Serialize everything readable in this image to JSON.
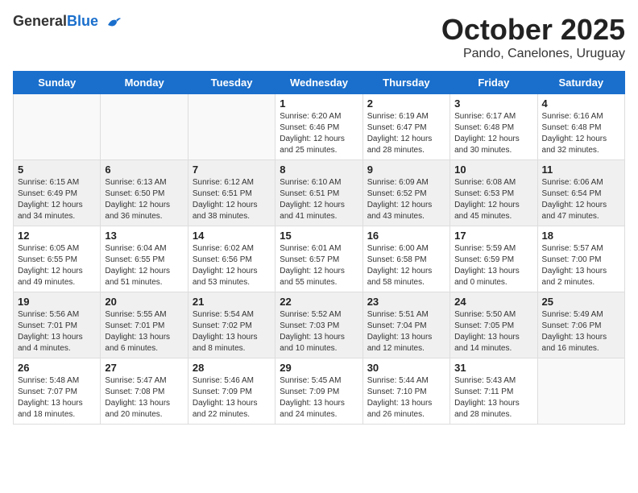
{
  "logo": {
    "general": "General",
    "blue": "Blue"
  },
  "title": "October 2025",
  "location": "Pando, Canelones, Uruguay",
  "days_of_week": [
    "Sunday",
    "Monday",
    "Tuesday",
    "Wednesday",
    "Thursday",
    "Friday",
    "Saturday"
  ],
  "weeks": [
    {
      "shaded": false,
      "days": [
        {
          "num": "",
          "info": ""
        },
        {
          "num": "",
          "info": ""
        },
        {
          "num": "",
          "info": ""
        },
        {
          "num": "1",
          "info": "Sunrise: 6:20 AM\nSunset: 6:46 PM\nDaylight: 12 hours\nand 25 minutes."
        },
        {
          "num": "2",
          "info": "Sunrise: 6:19 AM\nSunset: 6:47 PM\nDaylight: 12 hours\nand 28 minutes."
        },
        {
          "num": "3",
          "info": "Sunrise: 6:17 AM\nSunset: 6:48 PM\nDaylight: 12 hours\nand 30 minutes."
        },
        {
          "num": "4",
          "info": "Sunrise: 6:16 AM\nSunset: 6:48 PM\nDaylight: 12 hours\nand 32 minutes."
        }
      ]
    },
    {
      "shaded": true,
      "days": [
        {
          "num": "5",
          "info": "Sunrise: 6:15 AM\nSunset: 6:49 PM\nDaylight: 12 hours\nand 34 minutes."
        },
        {
          "num": "6",
          "info": "Sunrise: 6:13 AM\nSunset: 6:50 PM\nDaylight: 12 hours\nand 36 minutes."
        },
        {
          "num": "7",
          "info": "Sunrise: 6:12 AM\nSunset: 6:51 PM\nDaylight: 12 hours\nand 38 minutes."
        },
        {
          "num": "8",
          "info": "Sunrise: 6:10 AM\nSunset: 6:51 PM\nDaylight: 12 hours\nand 41 minutes."
        },
        {
          "num": "9",
          "info": "Sunrise: 6:09 AM\nSunset: 6:52 PM\nDaylight: 12 hours\nand 43 minutes."
        },
        {
          "num": "10",
          "info": "Sunrise: 6:08 AM\nSunset: 6:53 PM\nDaylight: 12 hours\nand 45 minutes."
        },
        {
          "num": "11",
          "info": "Sunrise: 6:06 AM\nSunset: 6:54 PM\nDaylight: 12 hours\nand 47 minutes."
        }
      ]
    },
    {
      "shaded": false,
      "days": [
        {
          "num": "12",
          "info": "Sunrise: 6:05 AM\nSunset: 6:55 PM\nDaylight: 12 hours\nand 49 minutes."
        },
        {
          "num": "13",
          "info": "Sunrise: 6:04 AM\nSunset: 6:55 PM\nDaylight: 12 hours\nand 51 minutes."
        },
        {
          "num": "14",
          "info": "Sunrise: 6:02 AM\nSunset: 6:56 PM\nDaylight: 12 hours\nand 53 minutes."
        },
        {
          "num": "15",
          "info": "Sunrise: 6:01 AM\nSunset: 6:57 PM\nDaylight: 12 hours\nand 55 minutes."
        },
        {
          "num": "16",
          "info": "Sunrise: 6:00 AM\nSunset: 6:58 PM\nDaylight: 12 hours\nand 58 minutes."
        },
        {
          "num": "17",
          "info": "Sunrise: 5:59 AM\nSunset: 6:59 PM\nDaylight: 13 hours\nand 0 minutes."
        },
        {
          "num": "18",
          "info": "Sunrise: 5:57 AM\nSunset: 7:00 PM\nDaylight: 13 hours\nand 2 minutes."
        }
      ]
    },
    {
      "shaded": true,
      "days": [
        {
          "num": "19",
          "info": "Sunrise: 5:56 AM\nSunset: 7:01 PM\nDaylight: 13 hours\nand 4 minutes."
        },
        {
          "num": "20",
          "info": "Sunrise: 5:55 AM\nSunset: 7:01 PM\nDaylight: 13 hours\nand 6 minutes."
        },
        {
          "num": "21",
          "info": "Sunrise: 5:54 AM\nSunset: 7:02 PM\nDaylight: 13 hours\nand 8 minutes."
        },
        {
          "num": "22",
          "info": "Sunrise: 5:52 AM\nSunset: 7:03 PM\nDaylight: 13 hours\nand 10 minutes."
        },
        {
          "num": "23",
          "info": "Sunrise: 5:51 AM\nSunset: 7:04 PM\nDaylight: 13 hours\nand 12 minutes."
        },
        {
          "num": "24",
          "info": "Sunrise: 5:50 AM\nSunset: 7:05 PM\nDaylight: 13 hours\nand 14 minutes."
        },
        {
          "num": "25",
          "info": "Sunrise: 5:49 AM\nSunset: 7:06 PM\nDaylight: 13 hours\nand 16 minutes."
        }
      ]
    },
    {
      "shaded": false,
      "days": [
        {
          "num": "26",
          "info": "Sunrise: 5:48 AM\nSunset: 7:07 PM\nDaylight: 13 hours\nand 18 minutes."
        },
        {
          "num": "27",
          "info": "Sunrise: 5:47 AM\nSunset: 7:08 PM\nDaylight: 13 hours\nand 20 minutes."
        },
        {
          "num": "28",
          "info": "Sunrise: 5:46 AM\nSunset: 7:09 PM\nDaylight: 13 hours\nand 22 minutes."
        },
        {
          "num": "29",
          "info": "Sunrise: 5:45 AM\nSunset: 7:09 PM\nDaylight: 13 hours\nand 24 minutes."
        },
        {
          "num": "30",
          "info": "Sunrise: 5:44 AM\nSunset: 7:10 PM\nDaylight: 13 hours\nand 26 minutes."
        },
        {
          "num": "31",
          "info": "Sunrise: 5:43 AM\nSunset: 7:11 PM\nDaylight: 13 hours\nand 28 minutes."
        },
        {
          "num": "",
          "info": ""
        }
      ]
    }
  ]
}
